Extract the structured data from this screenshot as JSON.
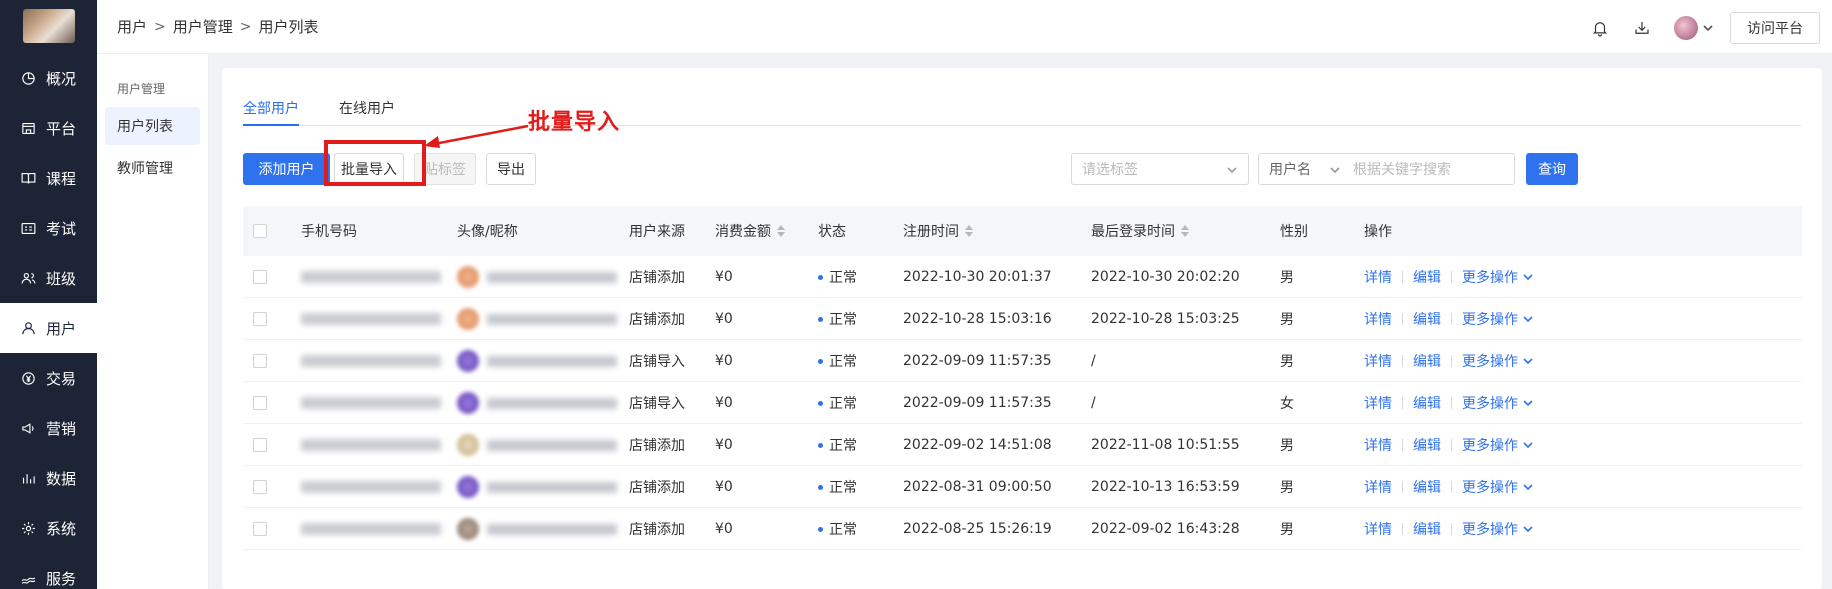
{
  "nav": {
    "items": [
      {
        "label": "概况",
        "icon": "pie-chart-icon"
      },
      {
        "label": "平台",
        "icon": "store-icon"
      },
      {
        "label": "课程",
        "icon": "book-icon"
      },
      {
        "label": "考试",
        "icon": "exam-icon"
      },
      {
        "label": "班级",
        "icon": "group-icon"
      },
      {
        "label": "用户",
        "icon": "user-icon"
      },
      {
        "label": "交易",
        "icon": "yen-circle-icon"
      },
      {
        "label": "营销",
        "icon": "megaphone-icon"
      },
      {
        "label": "数据",
        "icon": "bar-chart-icon"
      },
      {
        "label": "系统",
        "icon": "gear-icon"
      },
      {
        "label": "服务",
        "icon": "service-icon"
      }
    ],
    "active_index": 5
  },
  "breadcrumb": [
    "用户",
    "用户管理",
    "用户列表"
  ],
  "header": {
    "visit_label": "访问平台"
  },
  "submenu": {
    "group": "用户管理",
    "items": [
      "用户列表",
      "教师管理"
    ],
    "active_index": 0
  },
  "tabs": [
    "全部用户",
    "在线用户"
  ],
  "toolbar": {
    "add": "添加用户",
    "import": "批量导入",
    "tag": "贴标签",
    "export": "导出",
    "tag_placeholder": "请选标签",
    "field": "用户名",
    "keyword_placeholder": "根据关键字搜索",
    "query": "查询"
  },
  "annotation": {
    "text": "批量导入",
    "color": "#e21b1b"
  },
  "table": {
    "headers": {
      "phone": "手机号码",
      "avatar": "头像/昵称",
      "source": "用户来源",
      "spend": "消费金额",
      "status": "状态",
      "reg": "注册时间",
      "last": "最后登录时间",
      "gender": "性别",
      "ops": "操作"
    },
    "rows": [
      {
        "source": "店铺添加",
        "spend": "¥0",
        "status": "正常",
        "reg": "2022-10-30 20:01:37",
        "last": "2022-10-30 20:02:20",
        "gender": "男"
      },
      {
        "source": "店铺添加",
        "spend": "¥0",
        "status": "正常",
        "reg": "2022-10-28 15:03:16",
        "last": "2022-10-28 15:03:25",
        "gender": "男"
      },
      {
        "source": "店铺导入",
        "spend": "¥0",
        "status": "正常",
        "reg": "2022-09-09 11:57:35",
        "last": "/",
        "gender": "男"
      },
      {
        "source": "店铺导入",
        "spend": "¥0",
        "status": "正常",
        "reg": "2022-09-09 11:57:35",
        "last": "/",
        "gender": "女"
      },
      {
        "source": "店铺添加",
        "spend": "¥0",
        "status": "正常",
        "reg": "2022-09-02 14:51:08",
        "last": "2022-11-08 10:51:55",
        "gender": "男"
      },
      {
        "source": "店铺添加",
        "spend": "¥0",
        "status": "正常",
        "reg": "2022-08-31 09:00:50",
        "last": "2022-10-13 16:53:59",
        "gender": "男"
      },
      {
        "source": "店铺添加",
        "spend": "¥0",
        "status": "正常",
        "reg": "2022-08-25 15:26:19",
        "last": "2022-09-02 16:43:28",
        "gender": "男"
      }
    ],
    "ops": {
      "detail": "详情",
      "edit": "编辑",
      "more": "更多操作"
    }
  }
}
